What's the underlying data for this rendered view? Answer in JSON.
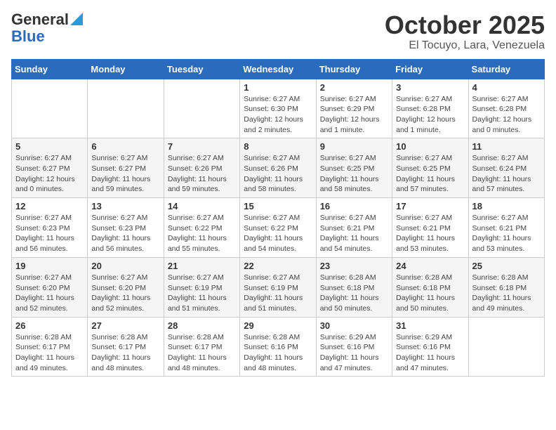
{
  "header": {
    "logo_general": "General",
    "logo_blue": "Blue",
    "month": "October 2025",
    "location": "El Tocuyo, Lara, Venezuela"
  },
  "days_of_week": [
    "Sunday",
    "Monday",
    "Tuesday",
    "Wednesday",
    "Thursday",
    "Friday",
    "Saturday"
  ],
  "weeks": [
    [
      {
        "day": "",
        "info": ""
      },
      {
        "day": "",
        "info": ""
      },
      {
        "day": "",
        "info": ""
      },
      {
        "day": "1",
        "info": "Sunrise: 6:27 AM\nSunset: 6:30 PM\nDaylight: 12 hours\nand 2 minutes."
      },
      {
        "day": "2",
        "info": "Sunrise: 6:27 AM\nSunset: 6:29 PM\nDaylight: 12 hours\nand 1 minute."
      },
      {
        "day": "3",
        "info": "Sunrise: 6:27 AM\nSunset: 6:28 PM\nDaylight: 12 hours\nand 1 minute."
      },
      {
        "day": "4",
        "info": "Sunrise: 6:27 AM\nSunset: 6:28 PM\nDaylight: 12 hours\nand 0 minutes."
      }
    ],
    [
      {
        "day": "5",
        "info": "Sunrise: 6:27 AM\nSunset: 6:27 PM\nDaylight: 12 hours\nand 0 minutes."
      },
      {
        "day": "6",
        "info": "Sunrise: 6:27 AM\nSunset: 6:27 PM\nDaylight: 11 hours\nand 59 minutes."
      },
      {
        "day": "7",
        "info": "Sunrise: 6:27 AM\nSunset: 6:26 PM\nDaylight: 11 hours\nand 59 minutes."
      },
      {
        "day": "8",
        "info": "Sunrise: 6:27 AM\nSunset: 6:26 PM\nDaylight: 11 hours\nand 58 minutes."
      },
      {
        "day": "9",
        "info": "Sunrise: 6:27 AM\nSunset: 6:25 PM\nDaylight: 11 hours\nand 58 minutes."
      },
      {
        "day": "10",
        "info": "Sunrise: 6:27 AM\nSunset: 6:25 PM\nDaylight: 11 hours\nand 57 minutes."
      },
      {
        "day": "11",
        "info": "Sunrise: 6:27 AM\nSunset: 6:24 PM\nDaylight: 11 hours\nand 57 minutes."
      }
    ],
    [
      {
        "day": "12",
        "info": "Sunrise: 6:27 AM\nSunset: 6:23 PM\nDaylight: 11 hours\nand 56 minutes."
      },
      {
        "day": "13",
        "info": "Sunrise: 6:27 AM\nSunset: 6:23 PM\nDaylight: 11 hours\nand 56 minutes."
      },
      {
        "day": "14",
        "info": "Sunrise: 6:27 AM\nSunset: 6:22 PM\nDaylight: 11 hours\nand 55 minutes."
      },
      {
        "day": "15",
        "info": "Sunrise: 6:27 AM\nSunset: 6:22 PM\nDaylight: 11 hours\nand 54 minutes."
      },
      {
        "day": "16",
        "info": "Sunrise: 6:27 AM\nSunset: 6:21 PM\nDaylight: 11 hours\nand 54 minutes."
      },
      {
        "day": "17",
        "info": "Sunrise: 6:27 AM\nSunset: 6:21 PM\nDaylight: 11 hours\nand 53 minutes."
      },
      {
        "day": "18",
        "info": "Sunrise: 6:27 AM\nSunset: 6:21 PM\nDaylight: 11 hours\nand 53 minutes."
      }
    ],
    [
      {
        "day": "19",
        "info": "Sunrise: 6:27 AM\nSunset: 6:20 PM\nDaylight: 11 hours\nand 52 minutes."
      },
      {
        "day": "20",
        "info": "Sunrise: 6:27 AM\nSunset: 6:20 PM\nDaylight: 11 hours\nand 52 minutes."
      },
      {
        "day": "21",
        "info": "Sunrise: 6:27 AM\nSunset: 6:19 PM\nDaylight: 11 hours\nand 51 minutes."
      },
      {
        "day": "22",
        "info": "Sunrise: 6:27 AM\nSunset: 6:19 PM\nDaylight: 11 hours\nand 51 minutes."
      },
      {
        "day": "23",
        "info": "Sunrise: 6:28 AM\nSunset: 6:18 PM\nDaylight: 11 hours\nand 50 minutes."
      },
      {
        "day": "24",
        "info": "Sunrise: 6:28 AM\nSunset: 6:18 PM\nDaylight: 11 hours\nand 50 minutes."
      },
      {
        "day": "25",
        "info": "Sunrise: 6:28 AM\nSunset: 6:18 PM\nDaylight: 11 hours\nand 49 minutes."
      }
    ],
    [
      {
        "day": "26",
        "info": "Sunrise: 6:28 AM\nSunset: 6:17 PM\nDaylight: 11 hours\nand 49 minutes."
      },
      {
        "day": "27",
        "info": "Sunrise: 6:28 AM\nSunset: 6:17 PM\nDaylight: 11 hours\nand 48 minutes."
      },
      {
        "day": "28",
        "info": "Sunrise: 6:28 AM\nSunset: 6:17 PM\nDaylight: 11 hours\nand 48 minutes."
      },
      {
        "day": "29",
        "info": "Sunrise: 6:28 AM\nSunset: 6:16 PM\nDaylight: 11 hours\nand 48 minutes."
      },
      {
        "day": "30",
        "info": "Sunrise: 6:29 AM\nSunset: 6:16 PM\nDaylight: 11 hours\nand 47 minutes."
      },
      {
        "day": "31",
        "info": "Sunrise: 6:29 AM\nSunset: 6:16 PM\nDaylight: 11 hours\nand 47 minutes."
      },
      {
        "day": "",
        "info": ""
      }
    ]
  ]
}
